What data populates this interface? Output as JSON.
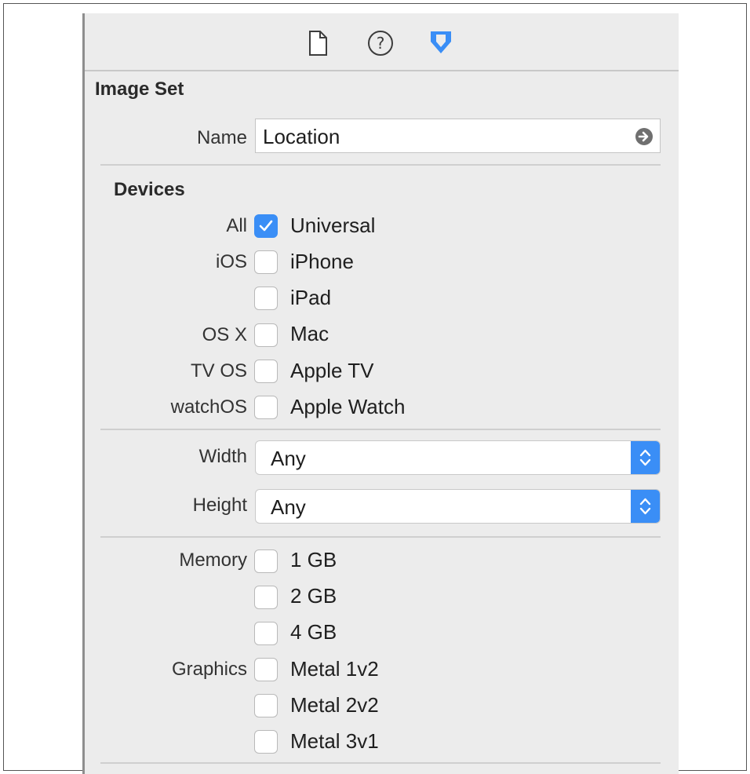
{
  "toolbar": {
    "icons": [
      "file-inspector-icon",
      "quick-help-icon",
      "attributes-inspector-icon"
    ],
    "active_icon": "attributes-inspector-icon",
    "accent_color": "#3a8ef6"
  },
  "image_set": {
    "title": "Image Set",
    "name_label": "Name",
    "name_value": "Location"
  },
  "devices": {
    "title": "Devices",
    "rows": [
      {
        "group": "All",
        "label": "Universal",
        "checked": true
      },
      {
        "group": "iOS",
        "label": "iPhone",
        "checked": false
      },
      {
        "group": "",
        "label": "iPad",
        "checked": false
      },
      {
        "group": "OS X",
        "label": "Mac",
        "checked": false
      },
      {
        "group": "TV OS",
        "label": "Apple TV",
        "checked": false
      },
      {
        "group": "watchOS",
        "label": "Apple Watch",
        "checked": false
      }
    ]
  },
  "size_class": {
    "width_label": "Width",
    "width_value": "Any",
    "height_label": "Height",
    "height_value": "Any"
  },
  "memory": {
    "label": "Memory",
    "options": [
      {
        "label": "1 GB",
        "checked": false
      },
      {
        "label": "2 GB",
        "checked": false
      },
      {
        "label": "4 GB",
        "checked": false
      }
    ]
  },
  "graphics": {
    "label": "Graphics",
    "options": [
      {
        "label": "Metal 1v2",
        "checked": false
      },
      {
        "label": "Metal 2v2",
        "checked": false
      },
      {
        "label": "Metal 3v1",
        "checked": false
      }
    ]
  }
}
